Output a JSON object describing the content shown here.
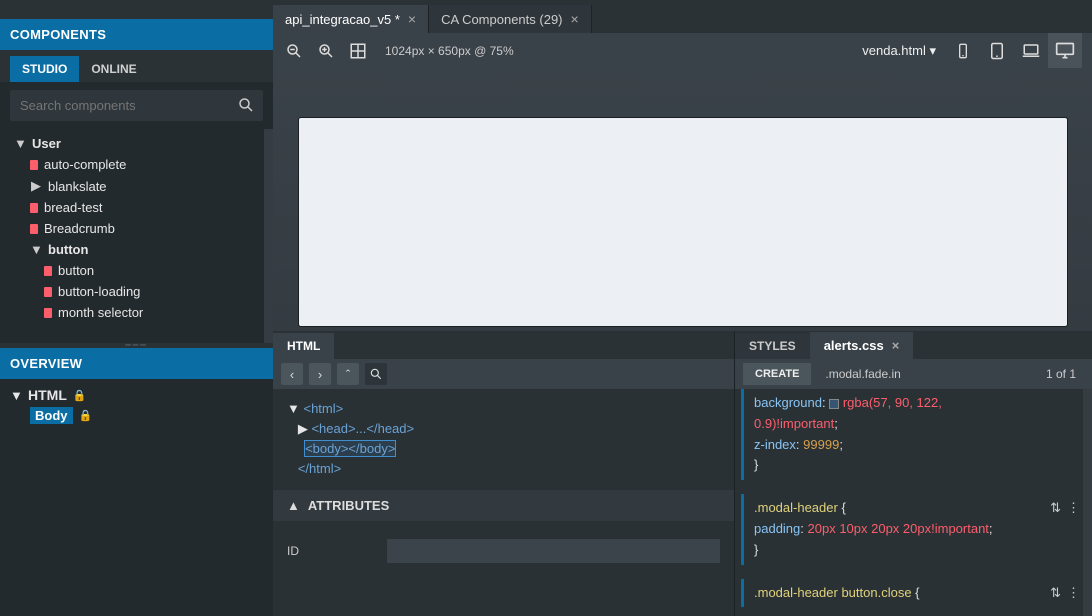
{
  "sidebar": {
    "header": "COMPONENTS",
    "tabs": {
      "studio": "STUDIO",
      "online": "ONLINE"
    },
    "search_placeholder": "Search components",
    "tree": {
      "user_cat": "User",
      "items": [
        "auto-complete",
        "blankslate",
        "bread-test",
        "Breadcrumb"
      ],
      "button_cat": "button",
      "button_items": [
        "button",
        "button-loading",
        "month selector"
      ]
    }
  },
  "overview": {
    "header": "OVERVIEW",
    "html": "HTML",
    "body": "Body"
  },
  "file_tabs": [
    {
      "label": "api_integracao_v5 *"
    },
    {
      "label": "CA Components (29)"
    }
  ],
  "toolbar": {
    "dims": "1024px × 650px @ 75%",
    "filename": "venda.html"
  },
  "html_panel": {
    "tab": "HTML",
    "lines": {
      "open": "<html>",
      "head": "<head>...</head>",
      "body": "<body></body>",
      "close": "</html>"
    },
    "attrs_header": "ATTRIBUTES",
    "attrs_id": "ID"
  },
  "styles_panel": {
    "tab_styles": "STYLES",
    "tab_file": "alerts.css",
    "create": "CREATE",
    "selector": ".modal.fade.in",
    "count": "1 of 1",
    "rule0": {
      "l1a": "background",
      "l1b": "rgba(57, 90, 122,",
      "l2": "0.9)!important",
      "l3a": "z-index",
      "l3b": "99999"
    },
    "rule1": {
      "sel": ".modal-header",
      "prop": "padding",
      "val": "20px 10px 20px 20px!important"
    },
    "rule2": {
      "sel": ".modal-header button.close"
    }
  }
}
